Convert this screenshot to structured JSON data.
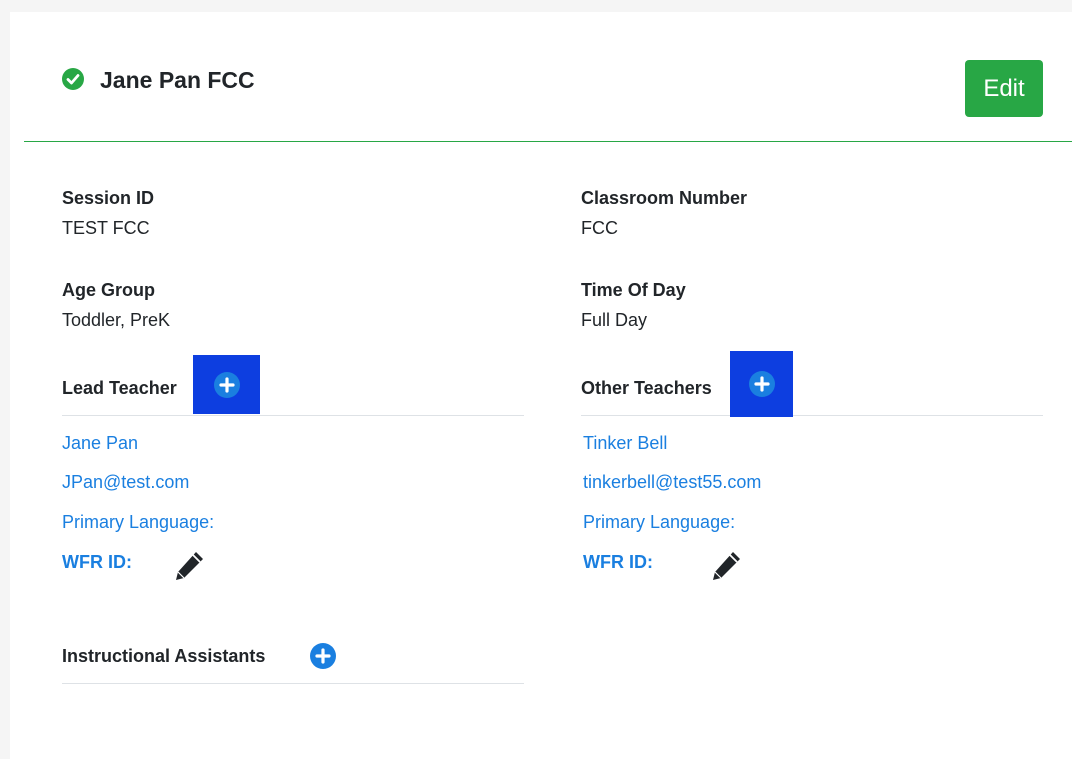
{
  "header": {
    "title": "Jane Pan FCC",
    "edit_label": "Edit",
    "check_icon": "check-circle-icon"
  },
  "fields": {
    "session_id": {
      "label": "Session ID",
      "value": "TEST FCC"
    },
    "classroom_number": {
      "label": "Classroom Number",
      "value": "FCC"
    },
    "age_group": {
      "label": "Age Group",
      "value": "Toddler, PreK"
    },
    "time_of_day": {
      "label": "Time Of Day",
      "value": "Full Day"
    }
  },
  "lead_teacher": {
    "title": "Lead Teacher",
    "name": "Jane Pan",
    "email": "JPan@test.com",
    "primary_language": "Primary Language:",
    "wfr_id": "WFR ID:"
  },
  "other_teachers": {
    "title": "Other Teachers",
    "name": "Tinker Bell",
    "email": "tinkerbell@test55.com",
    "primary_language": "Primary Language:",
    "wfr_id": "WFR ID:"
  },
  "instructional_assistants": {
    "title": "Instructional Assistants"
  },
  "colors": {
    "success": "#28a745",
    "link": "#1a7fe0",
    "highlight": "#0d3ee0"
  }
}
